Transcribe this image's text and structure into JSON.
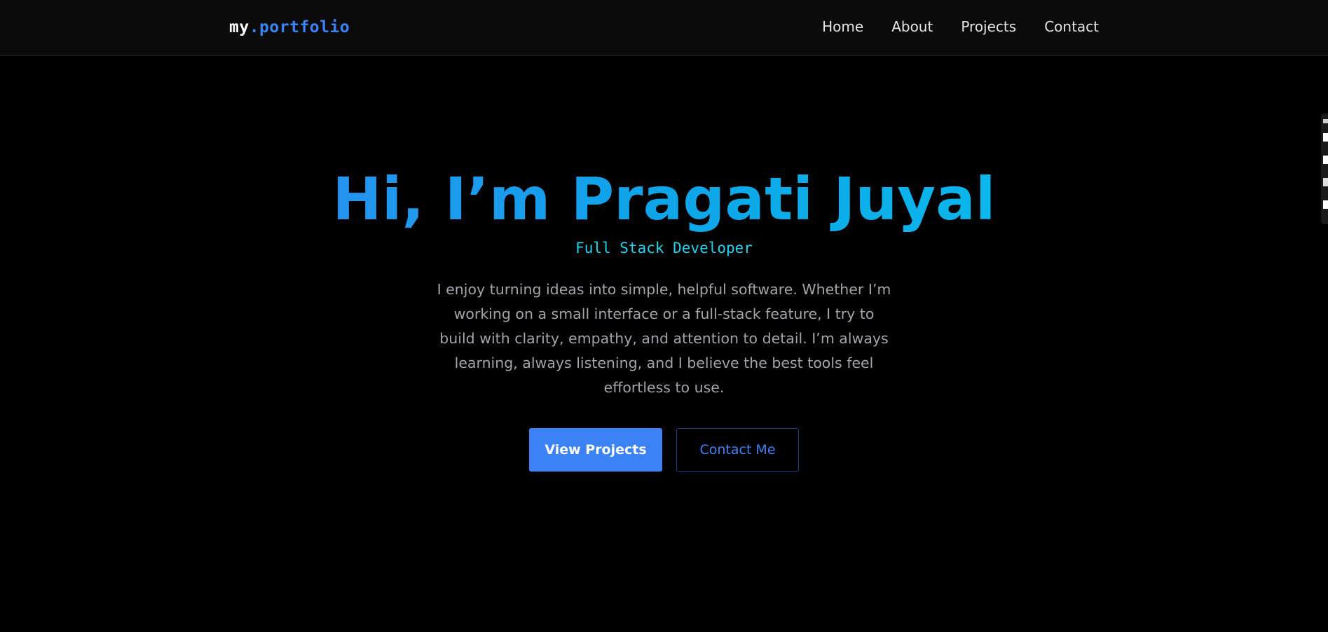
{
  "nav": {
    "logo_prefix": "my",
    "logo_suffix": ".portfolio",
    "links": [
      "Home",
      "About",
      "Projects",
      "Contact"
    ]
  },
  "hero": {
    "title": "Hi, I’m Pragati Juyal",
    "subtitle": "Full Stack Developer",
    "description": "I enjoy turning ideas into simple, helpful software. Whether I’m working on a small interface or a full-stack feature, I try to build with clarity, empathy, and attention to detail. I’m always learning, always listening, and I believe the best tools feel effortless to use.",
    "primary_button": "View Projects",
    "secondary_button": "Contact Me"
  },
  "colors": {
    "background": "#000000",
    "navbar": "#0b0b0b",
    "accent": "#3b82f6",
    "accent_cyan": "#22d3ee",
    "body_text": "#a3a3ab"
  }
}
